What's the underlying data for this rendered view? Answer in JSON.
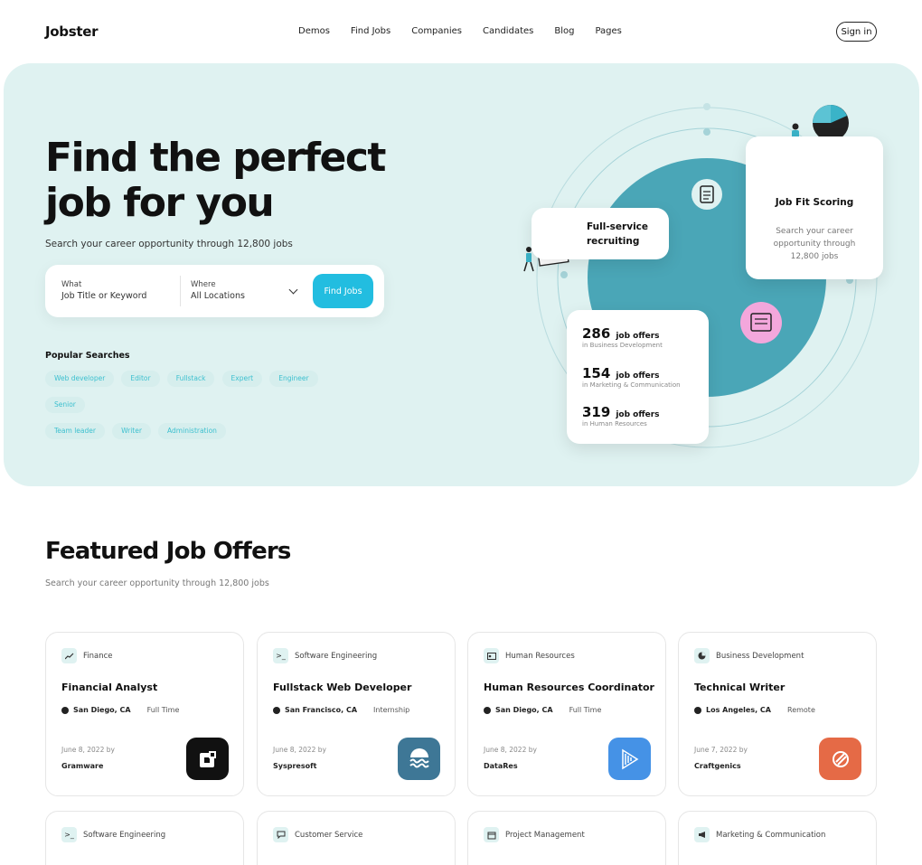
{
  "header": {
    "logo": "Jobster",
    "nav": [
      "Demos",
      "Find Jobs",
      "Companies",
      "Candidates",
      "Blog",
      "Pages"
    ],
    "signin_label": "Sign in"
  },
  "hero": {
    "title_line1": "Find the perfect",
    "title_line2": "job for you",
    "subtitle": "Search your career opportunity through 12,800 jobs",
    "search": {
      "what_label": "What",
      "what_placeholder": "Job Title or Keyword",
      "where_label": "Where",
      "where_value": "All Locations",
      "button": "Find Jobs"
    },
    "popular_title": "Popular Searches",
    "tags": [
      "Web developer",
      "Editor",
      "Fullstack",
      "Expert",
      "Engineer",
      "Senior",
      "Team leader",
      "Writer",
      "Administration"
    ],
    "recruit_card": "Full-service recruiting",
    "fit_card": {
      "title": "Job Fit Scoring",
      "desc": "Search your career opportunity through 12,800 jobs"
    },
    "stats": [
      {
        "num": "286",
        "label": "job offers",
        "sub": "in Business Development"
      },
      {
        "num": "154",
        "label": "job offers",
        "sub": "in Marketing & Communication"
      },
      {
        "num": "319",
        "label": "job offers",
        "sub": "in Human Resources"
      }
    ],
    "colors": {
      "bg": "#dff2f1",
      "teal": "#4aa6b7",
      "accent": "#22bde0",
      "pink": "#f3a7dc"
    }
  },
  "featured": {
    "title": "Featured Job Offers",
    "subtitle": "Search your career opportunity through 12,800 jobs",
    "jobs": [
      {
        "category": "Finance",
        "cat_icon": "chart-icon",
        "title": "Financial Analyst",
        "location": "San Diego, CA",
        "type": "Full Time",
        "date": "June 8, 2022 by",
        "company": "Gramware",
        "logo_color": "#111111"
      },
      {
        "category": "Software Engineering",
        "cat_icon": "terminal-icon",
        "title": "Fullstack Web Developer",
        "location": "San Francisco, CA",
        "type": "Internship",
        "date": "June 8, 2022 by",
        "company": "Syspresoft",
        "logo_color": "#3e7796"
      },
      {
        "category": "Human Resources",
        "cat_icon": "id-card-icon",
        "title": "Human Resources Coordinator",
        "location": "San Diego, CA",
        "type": "Full Time",
        "date": "June 8, 2022 by",
        "company": "DataRes",
        "logo_color": "#4592e6"
      },
      {
        "category": "Business Development",
        "cat_icon": "pie-icon",
        "title": "Technical Writer",
        "location": "Los Angeles, CA",
        "type": "Remote",
        "date": "June 7, 2022 by",
        "company": "Craftgenics",
        "logo_color": "#e56a46"
      }
    ],
    "jobs_row2": [
      {
        "category": "Software Engineering",
        "cat_icon": "terminal-icon"
      },
      {
        "category": "Customer Service",
        "cat_icon": "chat-icon"
      },
      {
        "category": "Project Management",
        "cat_icon": "calendar-icon"
      },
      {
        "category": "Marketing & Communication",
        "cat_icon": "megaphone-icon"
      }
    ]
  }
}
